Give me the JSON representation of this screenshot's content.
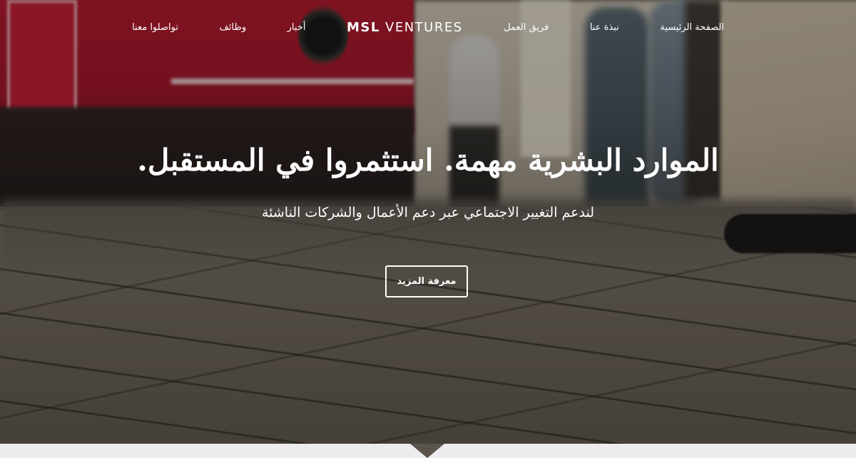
{
  "nav": {
    "items_right": [
      {
        "label": "الصفحة الرئيسية"
      },
      {
        "label": "نبذة عنا"
      },
      {
        "label": "فريق العمل"
      }
    ],
    "brand_bold": "MSL",
    "brand_rest": " VENTURES",
    "items_left": [
      {
        "label": "أخبار"
      },
      {
        "label": "وظائف"
      },
      {
        "label": "تواصلوا معنا"
      }
    ]
  },
  "hero": {
    "headline": "الموارد البشرية مهمة. استثمروا في المستقبل.",
    "subline": "لندعم التغيير الاجتماعي عبر دعم الأعمال والشركات الناشئة",
    "cta_label": "معرفة المزيد"
  },
  "colors": {
    "text": "#ffffff",
    "bottom_strip": "#ececee"
  }
}
